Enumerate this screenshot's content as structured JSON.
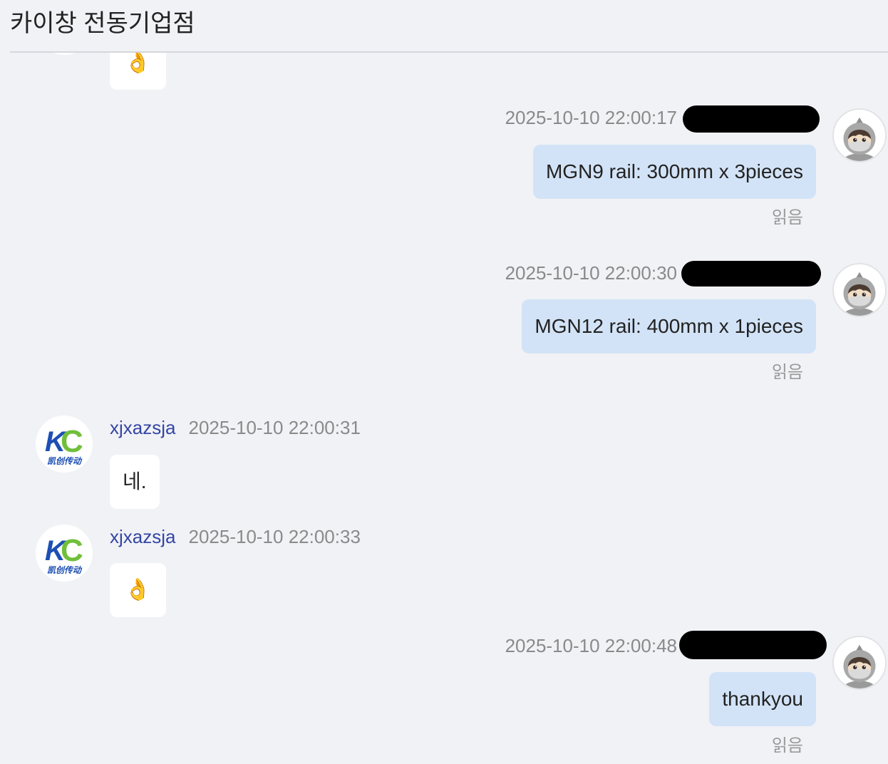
{
  "header": {
    "title": "카이창 전동기업점"
  },
  "contact_logo": {
    "letter_1": "K",
    "letter_2": "C",
    "caption": "凯创传动"
  },
  "colors": {
    "background": "#f1f2f6",
    "bubble_out": "#d3e3f7",
    "bubble_in": "#ffffff",
    "sender_name": "#3446a4",
    "logo_blue": "#1d4fb3",
    "logo_green": "#6fbf3b"
  },
  "messages": [
    {
      "outgoing": false,
      "text": "👌"
    },
    {
      "outgoing": true,
      "sender_redacted": true,
      "avatar_icon": "ninja-avatar-icon",
      "time": "2025-10-10 22:00:17",
      "text": "MGN9 rail: 300mm x 3pieces",
      "status": "읽음"
    },
    {
      "outgoing": true,
      "sender_redacted": true,
      "avatar_icon": "ninja-avatar-icon",
      "time": "2025-10-10 22:00:30",
      "text": "MGN12 rail: 400mm x 1pieces",
      "status": "읽음"
    },
    {
      "outgoing": false,
      "sender": "xjxazsja",
      "time": "2025-10-10 22:00:31",
      "text": "네."
    },
    {
      "outgoing": false,
      "sender": "xjxazsja",
      "time": "2025-10-10 22:00:33",
      "text": "👌"
    },
    {
      "outgoing": true,
      "sender_redacted": true,
      "avatar_icon": "ninja-avatar-icon",
      "time": "2025-10-10 22:00:48",
      "text": "thankyou",
      "status": "읽음"
    }
  ]
}
